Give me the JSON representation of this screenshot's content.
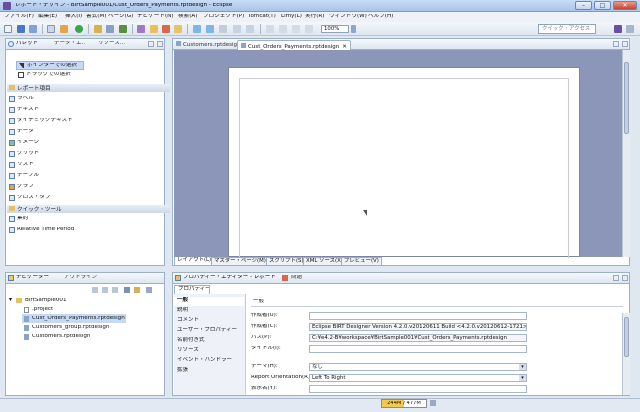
{
  "window": {
    "title": "レポート・デザイン - BirtSample001/Cust_Orders_Payments.rptdesign - Eclipse",
    "min": "–",
    "max": "□",
    "close": "✕"
  },
  "menu": [
    "ファイル(F)",
    "編集(E)",
    "挿入(I)",
    "書式(M)",
    "ページ(G)",
    "ナビゲート(N)",
    "検索(A)",
    "プロジェクト(P)",
    "Tomcat(T)",
    "Limy(L)",
    "実行(R)",
    "ウィンドウ(W)",
    "ヘルプ(H)"
  ],
  "toolbar": {
    "zoom": "100%",
    "quick_access_placeholder": "クイック・アクセス"
  },
  "palette": {
    "tabs": [
      "パレット",
      "データ・エ..",
      "リソース..."
    ],
    "tools": [
      "ポインターでの選択",
      "ドラッグでの選択"
    ],
    "report_items_header": "レポート項目",
    "report_items": [
      "ラベル",
      "テキスト",
      "ダイナミックテキスト",
      "データ",
      "イメージ",
      "グリッド",
      "リスト",
      "テーブル",
      "グラフ",
      "クロス・タブ"
    ],
    "quick_tools_header": "クイック・ツール",
    "quick_tools": [
      "集約",
      "Relative Time Period"
    ]
  },
  "editor": {
    "tabs": [
      "Customers.rptdesign",
      "Cust_Orders_Payments.rptdesign"
    ],
    "bottom_tabs": [
      "レイアウト(L)",
      "マスター・ページ(M)",
      "スクリプト(S)",
      "XML ソース(X)",
      "プレビュー(V)"
    ]
  },
  "navigator": {
    "tabs": [
      "ナビゲーター",
      "アウトライン"
    ],
    "project": "BirtSample001",
    "files": [
      ".project",
      "Cust_Orders_Payments.rptdesign",
      "Customers_group.rptdesign",
      "Customers.rptdesign"
    ]
  },
  "properties": {
    "tabs": [
      "プロパティー・エディター - レポート",
      "問題"
    ],
    "subtab": "プロパティー",
    "categories": [
      "一般",
      "説明",
      "コメント",
      "ユーザー・プロパティー",
      "名前付き式",
      "リソース",
      "イベント・ハンドラー",
      "拡張"
    ],
    "section": "一般",
    "fields": [
      {
        "label": "作成者(U):",
        "value": ""
      },
      {
        "label": "作成者(C):",
        "value": "Eclipse BIRT Designer Version 4.2.0.v20120611 Build <4.2.0.v20120612-1721>"
      },
      {
        "label": "パス(P):",
        "value": "C:¥e4.2-B¥workspace¥BirtSample001¥Cust_Orders_Payments.rptdesign"
      },
      {
        "label": "タイトル(I):",
        "value": ""
      },
      {
        "label": "テーマ(H):",
        "value": "なし"
      },
      {
        "label": "Report Orientation(R):",
        "value": "Left To Right"
      },
      {
        "label": "表示名(Y):",
        "value": ""
      }
    ]
  },
  "status": {
    "heap": "244M / 477M",
    "heap_used_fraction": 0.51
  },
  "colors": {
    "titlebar": "#b5cdee",
    "canvas": "#8b96b8",
    "selection": "#c5d9f4"
  }
}
